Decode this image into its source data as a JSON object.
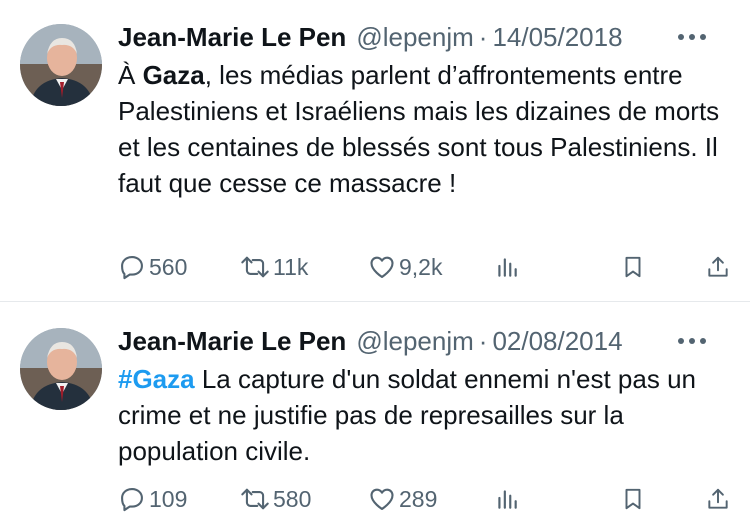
{
  "tweets": [
    {
      "author": "Jean-Marie Le Pen",
      "handle": "@lepenjm",
      "separator": "·",
      "date": "14/05/2018",
      "text_parts": [
        "À ",
        "Gaza",
        ", les médias parlent d’affrontements entre Palestiniens et Israéliens mais les dizaines de morts et les centaines de blessés sont tous Palestiniens. Il faut que cesse ce massacre !"
      ],
      "stats": {
        "replies": "560",
        "reposts": "11k",
        "likes": "9,2k"
      }
    },
    {
      "author": "Jean-Marie Le Pen",
      "handle": "@lepenjm",
      "separator": "·",
      "date": "02/08/2014",
      "text_parts": [
        "#Gaza",
        " La capture d'un soldat ennemi n'est pas un crime et ne justifie pas de represailles sur la population civile."
      ],
      "stats": {
        "replies": "109",
        "reposts": "580",
        "likes": "289"
      }
    }
  ],
  "icons": [
    "more-icon",
    "reply-icon",
    "repost-icon",
    "like-icon",
    "views-icon",
    "bookmark-icon",
    "share-icon"
  ],
  "colors": {
    "text": "#0f1419",
    "secondary": "#536471",
    "hashtag": "#1d9bf0",
    "divider": "#e6e9ec"
  }
}
